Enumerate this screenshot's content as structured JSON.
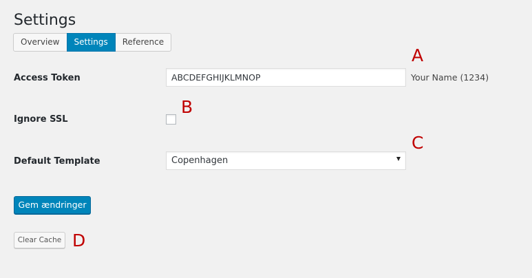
{
  "page": {
    "title": "Settings"
  },
  "tabs": [
    {
      "label": "Overview",
      "active": false
    },
    {
      "label": "Settings",
      "active": true
    },
    {
      "label": "Reference",
      "active": false
    }
  ],
  "colors": {
    "accent": "#0085ba",
    "annotation": "#c00000",
    "background": "#f1f1f1"
  },
  "form": {
    "access_token": {
      "label": "Access Token",
      "value": "ABCDEFGHIJKLMNOP",
      "owner": "Your Name (1234)"
    },
    "ignore_ssl": {
      "label": "Ignore SSL",
      "checked": false
    },
    "default_template": {
      "label": "Default Template",
      "selected": "Copenhagen"
    },
    "save_label": "Gem ændringer",
    "clear_cache_label": "Clear Cache"
  },
  "annotations": {
    "a": "A",
    "b": "B",
    "c": "C",
    "d": "D"
  }
}
